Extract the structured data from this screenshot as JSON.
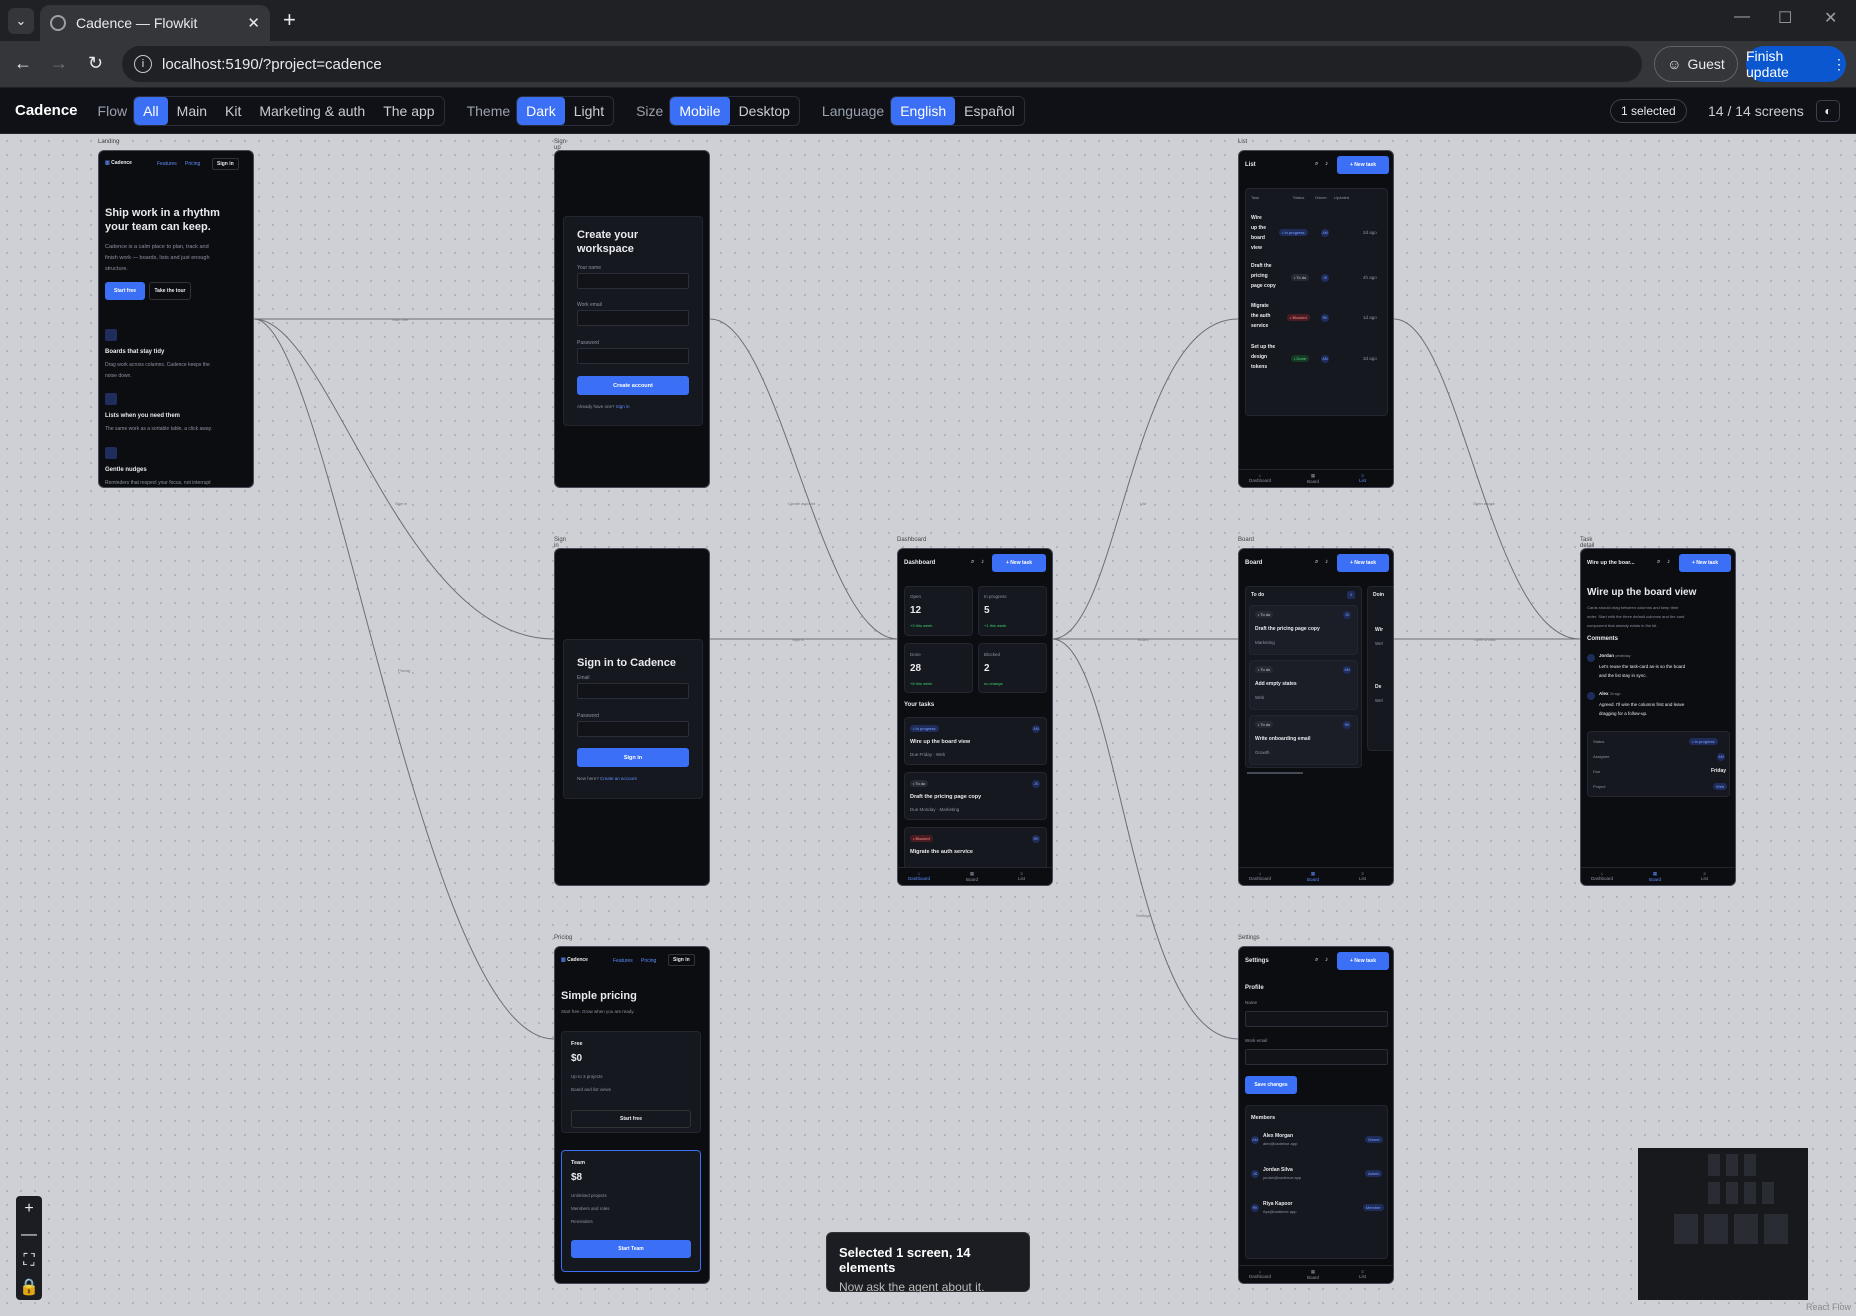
{
  "browser": {
    "tab_title": "Cadence — Flowkit",
    "url": "localhost:5190/?project=cadence",
    "guest": "Guest",
    "finish": "Finish update"
  },
  "toolbar": {
    "brand": "Cadence",
    "flow_label": "Flow",
    "flow_options": [
      "All",
      "Main",
      "Kit",
      "Marketing & auth",
      "The app"
    ],
    "theme_label": "Theme",
    "theme_options": [
      "Dark",
      "Light"
    ],
    "size_label": "Size",
    "size_options": [
      "Mobile",
      "Desktop"
    ],
    "language_label": "Language",
    "language_options": [
      "English",
      "Español"
    ],
    "selected_badge": "1 selected",
    "screen_count": "14 / 14 screens"
  },
  "edges": {
    "start_free": "Start free",
    "sign_in": "Sign in",
    "pricing": "Pricing",
    "create_account": "Create account",
    "sign_in2": "Sign in",
    "list": "List",
    "board": "Board",
    "settings": "Settings",
    "open_a_task": "Open a task",
    "open_a_task2": "Open a task"
  },
  "landing": {
    "label": "Landing",
    "logo": "Cadence",
    "nav_features": "Features",
    "nav_pricing": "Pricing",
    "sign_in": "Sign in",
    "headline1": "Ship work in a rhythm",
    "headline2": "your team can keep.",
    "body1": "Cadence is a calm place to plan, track and",
    "body2": "finish work — boards, lists and just enough",
    "body3": "structure.",
    "start_free": "Start free",
    "take_tour": "Take the tour",
    "f1_title": "Boards that stay tidy",
    "f1_body1": "Drag work across columns. Cadence keeps the",
    "f1_body2": "noise down.",
    "f2_title": "Lists when you need them",
    "f2_body": "The same work as a sortable table, a click away.",
    "f3_title": "Gentle nudges",
    "f3_body": "Reminders that respect your focus, not interrupt"
  },
  "signup": {
    "label": "Sign up",
    "title1": "Create your",
    "title2": "workspace",
    "name_label": "Your name",
    "email_label": "Work email",
    "password_label": "Password",
    "button": "Create account",
    "footer": "Already have one?",
    "footer_link": "Sign in"
  },
  "signin": {
    "label": "Sign in",
    "title": "Sign in to Cadence",
    "email_label": "Email",
    "password_label": "Password",
    "button": "Sign in",
    "footer": "New here?",
    "footer_link": "Create an account"
  },
  "pricing": {
    "label": "Pricing",
    "logo": "Cadence",
    "nav_features": "Features",
    "nav_pricing": "Pricing",
    "sign_in": "Sign in",
    "title": "Simple pricing",
    "subtitle": "Start free. Grow when you are ready.",
    "free_name": "Free",
    "free_price": "$0",
    "free_f1": "Up to 3 projects",
    "free_f2": "Board and list views",
    "free_btn": "Start free",
    "team_name": "Team",
    "team_price": "$8",
    "team_f1": "Unlimited projects",
    "team_f2": "Members and roles",
    "team_f3": "Reminders",
    "team_btn": "Start Team"
  },
  "dashboard": {
    "label": "Dashboard",
    "title": "Dashboard",
    "new_task": "+ New task",
    "stats": [
      {
        "label": "Open",
        "value": "12",
        "delta": "+3 this week"
      },
      {
        "label": "In progress",
        "value": "5",
        "delta": "+1 this week"
      },
      {
        "label": "Done",
        "value": "28",
        "delta": "+8 this week"
      },
      {
        "label": "Blocked",
        "value": "2",
        "delta": "no change"
      }
    ],
    "your_tasks": "Your tasks",
    "tasks": [
      {
        "status": "• In progress",
        "title": "Wire up the board view",
        "meta": "Due Friday · Web",
        "av": "AM"
      },
      {
        "status": "• To do",
        "title": "Draft the pricing page copy",
        "meta": "Due Monday · Marketing",
        "av": "JS"
      },
      {
        "status": "• Blocked",
        "title": "Migrate the auth service",
        "meta": "",
        "av": "RK"
      }
    ],
    "nav": [
      "Dashboard",
      "Board",
      "List"
    ]
  },
  "list": {
    "label": "List",
    "title": "List",
    "new_task": "+ New task",
    "cols": [
      "Task",
      "Status",
      "Owner",
      "Updated"
    ],
    "rows": [
      {
        "t1": "Wire",
        "t2": "up the",
        "t3": "board",
        "t4": "view",
        "status": "• In progress",
        "av": "AM",
        "updated": "2d ago"
      },
      {
        "t1": "Draft the",
        "t2": "pricing",
        "t3": "page copy",
        "t4": "",
        "status": "• To do",
        "av": "JS",
        "updated": "4h ago"
      },
      {
        "t1": "Migrate",
        "t2": "the auth",
        "t3": "service",
        "t4": "",
        "status": "• Blocked",
        "av": "RK",
        "updated": "1d ago"
      },
      {
        "t1": "Set up the",
        "t2": "design",
        "t3": "tokens",
        "t4": "",
        "status": "• Done",
        "av": "AM",
        "updated": "3d ago"
      }
    ],
    "nav": [
      "Dashboard",
      "Board",
      "List"
    ]
  },
  "board": {
    "label": "Board",
    "title": "Board",
    "new_task": "+ New task",
    "col_todo": "To do",
    "col_todo_count": "3",
    "col_doing": "Doin",
    "cards": [
      {
        "status": "• To do",
        "title": "Draft the pricing page copy",
        "tag": "Marketing",
        "av": "JS"
      },
      {
        "status": "• To do",
        "title": "Add empty states",
        "tag": "Web",
        "av": "AM"
      },
      {
        "status": "• To do",
        "title": "Write onboarding email",
        "tag": "Growth",
        "av": "RK"
      }
    ],
    "doing_snips": [
      "Wir",
      "Wel",
      "De",
      "Wel"
    ],
    "nav": [
      "Dashboard",
      "Board",
      "List"
    ]
  },
  "settings": {
    "label": "Settings",
    "title": "Settings",
    "new_task": "+ New task",
    "profile": "Profile",
    "name_label": "Name",
    "email_label": "Work email",
    "save": "Save changes",
    "members": "Members",
    "people": [
      {
        "av": "AM",
        "name": "Alex Morgan",
        "email": "alex@cadence.app",
        "role": "Owner"
      },
      {
        "av": "JS",
        "name": "Jordan Silva",
        "email": "jordan@cadence.app",
        "role": "Admin"
      },
      {
        "av": "RK",
        "name": "Riya Kapoor",
        "email": "riya@cadence.app",
        "role": "Member"
      }
    ],
    "nav": [
      "Dashboard",
      "Board",
      "List"
    ]
  },
  "detail": {
    "label": "Task detail",
    "title_bar": "Wire up the boar...",
    "new_task": "+ New task",
    "heading": "Wire up the board view",
    "body1": "Cards should drag between columns and keep their",
    "body2": "order. Start with the three default columns and the card",
    "body3": "component that already exists in the kit.",
    "comments": "Comments",
    "c1_name": "Jordan",
    "c1_time": "yesterday",
    "c1_text1": "Let's reuse the task-card as-is so the board",
    "c1_text2": "and the list stay in sync.",
    "c2_name": "Alex",
    "c2_time": "3h ago",
    "c2_text1": "Agreed. I'll wire the columns first and leave",
    "c2_text2": "dragging for a follow-up.",
    "status_label": "Status",
    "status_val": "• In progress",
    "assignee_label": "Assignee",
    "assignee_val": "AM",
    "due_label": "Due",
    "due_val": "Friday",
    "project_label": "Project",
    "project_val": "Web",
    "nav": [
      "Dashboard",
      "Board",
      "List"
    ]
  },
  "toast": {
    "title": "Selected 1 screen, 14 elements",
    "body": "Now ask the agent about it."
  },
  "watermark": "React Flow",
  "colors": {
    "accent": "#3b6ff5",
    "canvas": "#cfd0d6",
    "screen_bg": "#0c0d11"
  }
}
